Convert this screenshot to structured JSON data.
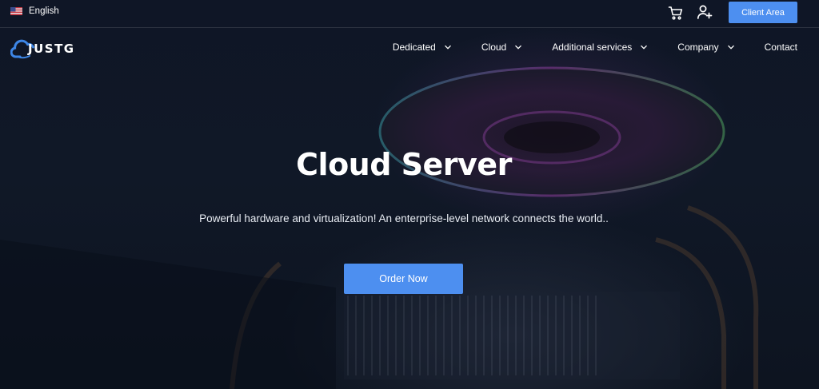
{
  "topbar": {
    "language": {
      "label": "English",
      "flag": "us-flag-icon"
    },
    "cart": {
      "icon": "cart-icon"
    },
    "account": {
      "icon": "user-add-icon"
    },
    "client_area_label": "Client Area"
  },
  "brand": {
    "logo_text": "JUSTG",
    "logo_icon": "cloud-icon"
  },
  "nav": {
    "items": [
      {
        "label": "Dedicated",
        "has_dropdown": true
      },
      {
        "label": "Cloud",
        "has_dropdown": true
      },
      {
        "label": "Additional services",
        "has_dropdown": true
      },
      {
        "label": "Company",
        "has_dropdown": true
      },
      {
        "label": "Contact",
        "has_dropdown": false
      }
    ]
  },
  "hero": {
    "title": "Cloud Server",
    "subtitle": "Powerful hardware and virtualization! An enterprise-level network connects the world..",
    "cta_label": "Order Now",
    "accent_color": "#4d8ff0"
  }
}
